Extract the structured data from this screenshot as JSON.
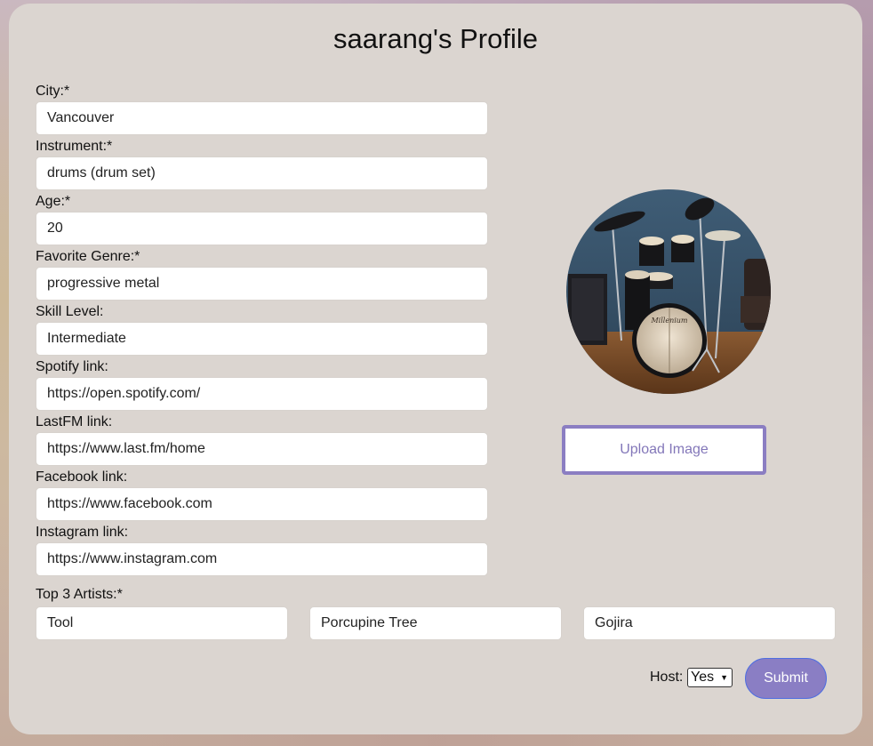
{
  "page": {
    "title": "saarang's Profile"
  },
  "fields": [
    {
      "label": "City:*",
      "value": "Vancouver"
    },
    {
      "label": "Instrument:*",
      "value": "drums (drum set)"
    },
    {
      "label": "Age:*",
      "value": "20"
    },
    {
      "label": "Favorite Genre:*",
      "value": "progressive metal"
    },
    {
      "label": "Skill Level:",
      "value": "Intermediate"
    },
    {
      "label": "Spotify link:",
      "value": "https://open.spotify.com/"
    },
    {
      "label": "LastFM link:",
      "value": "https://www.last.fm/home"
    },
    {
      "label": "Facebook link:",
      "value": "https://www.facebook.com"
    },
    {
      "label": "Instagram link:",
      "value": "https://www.instagram.com"
    }
  ],
  "profile_image": {
    "icon": "drum-kit-photo",
    "upload_label": "Upload Image"
  },
  "artists": {
    "label": "Top 3 Artists:*",
    "values": [
      "Tool",
      "Porcupine Tree",
      "Gojira"
    ]
  },
  "host": {
    "label": "Host:",
    "selected": "Yes"
  },
  "submit_label": "Submit",
  "colors": {
    "card_bg": "#dbd5d0",
    "accent": "#8a7ec4",
    "upload_border": "#8b7ec2"
  }
}
